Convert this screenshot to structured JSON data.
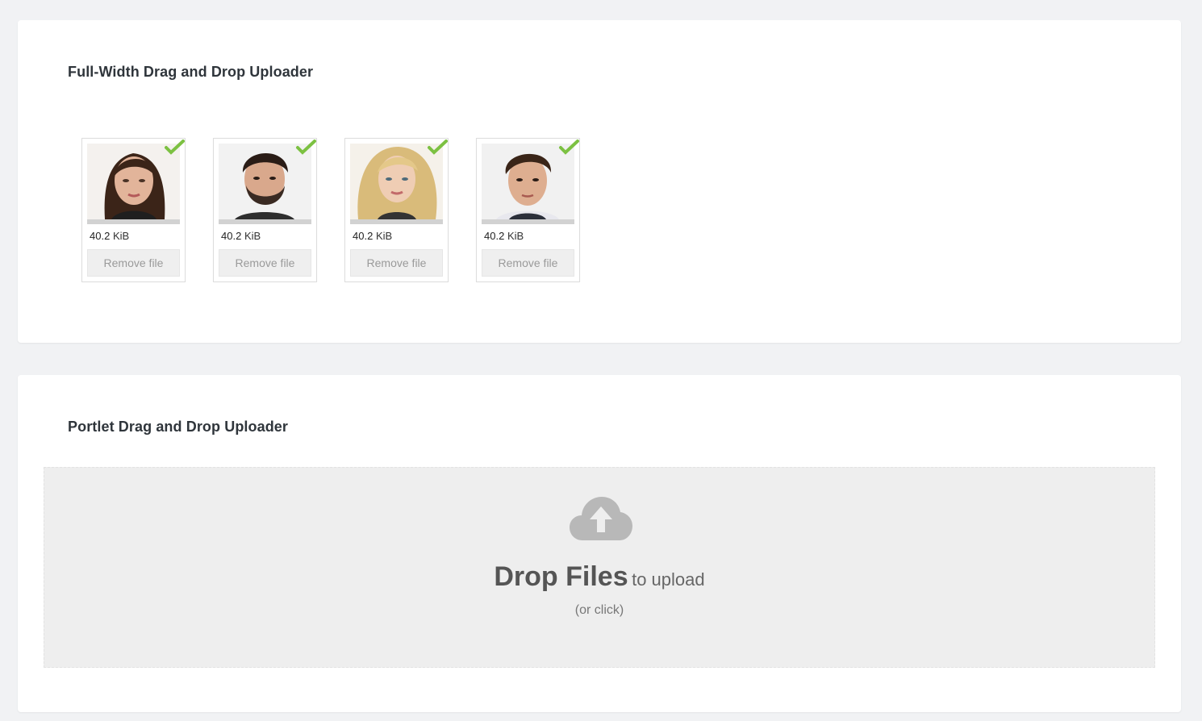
{
  "full_width_panel": {
    "title": "Full-Width Drag and Drop Uploader",
    "files": [
      {
        "size_num": "40.2",
        "size_unit": "KiB",
        "remove_label": "Remove file",
        "status": "success",
        "thumbnail": "woman-portrait-dark-hair"
      },
      {
        "size_num": "40.2",
        "size_unit": "KiB",
        "remove_label": "Remove file",
        "status": "success",
        "thumbnail": "man-portrait-beard"
      },
      {
        "size_num": "40.2",
        "size_unit": "KiB",
        "remove_label": "Remove file",
        "status": "success",
        "thumbnail": "woman-portrait-blonde"
      },
      {
        "size_num": "40.2",
        "size_unit": "KiB",
        "remove_label": "Remove file",
        "status": "success",
        "thumbnail": "man-portrait-short-hair"
      }
    ]
  },
  "portlet_panel": {
    "title": "Portlet Drag and Drop Uploader",
    "dropzone": {
      "icon": "cloud-upload-icon",
      "strong_text": "Drop Files",
      "light_text": "to upload",
      "hint": "(or click)"
    }
  },
  "colors": {
    "page_background": "#f1f2f4",
    "panel_background": "#ffffff",
    "dropzone_background": "#eeeeee",
    "success_check": "#7cc142",
    "cloud_icon": "#b8b8b8"
  }
}
